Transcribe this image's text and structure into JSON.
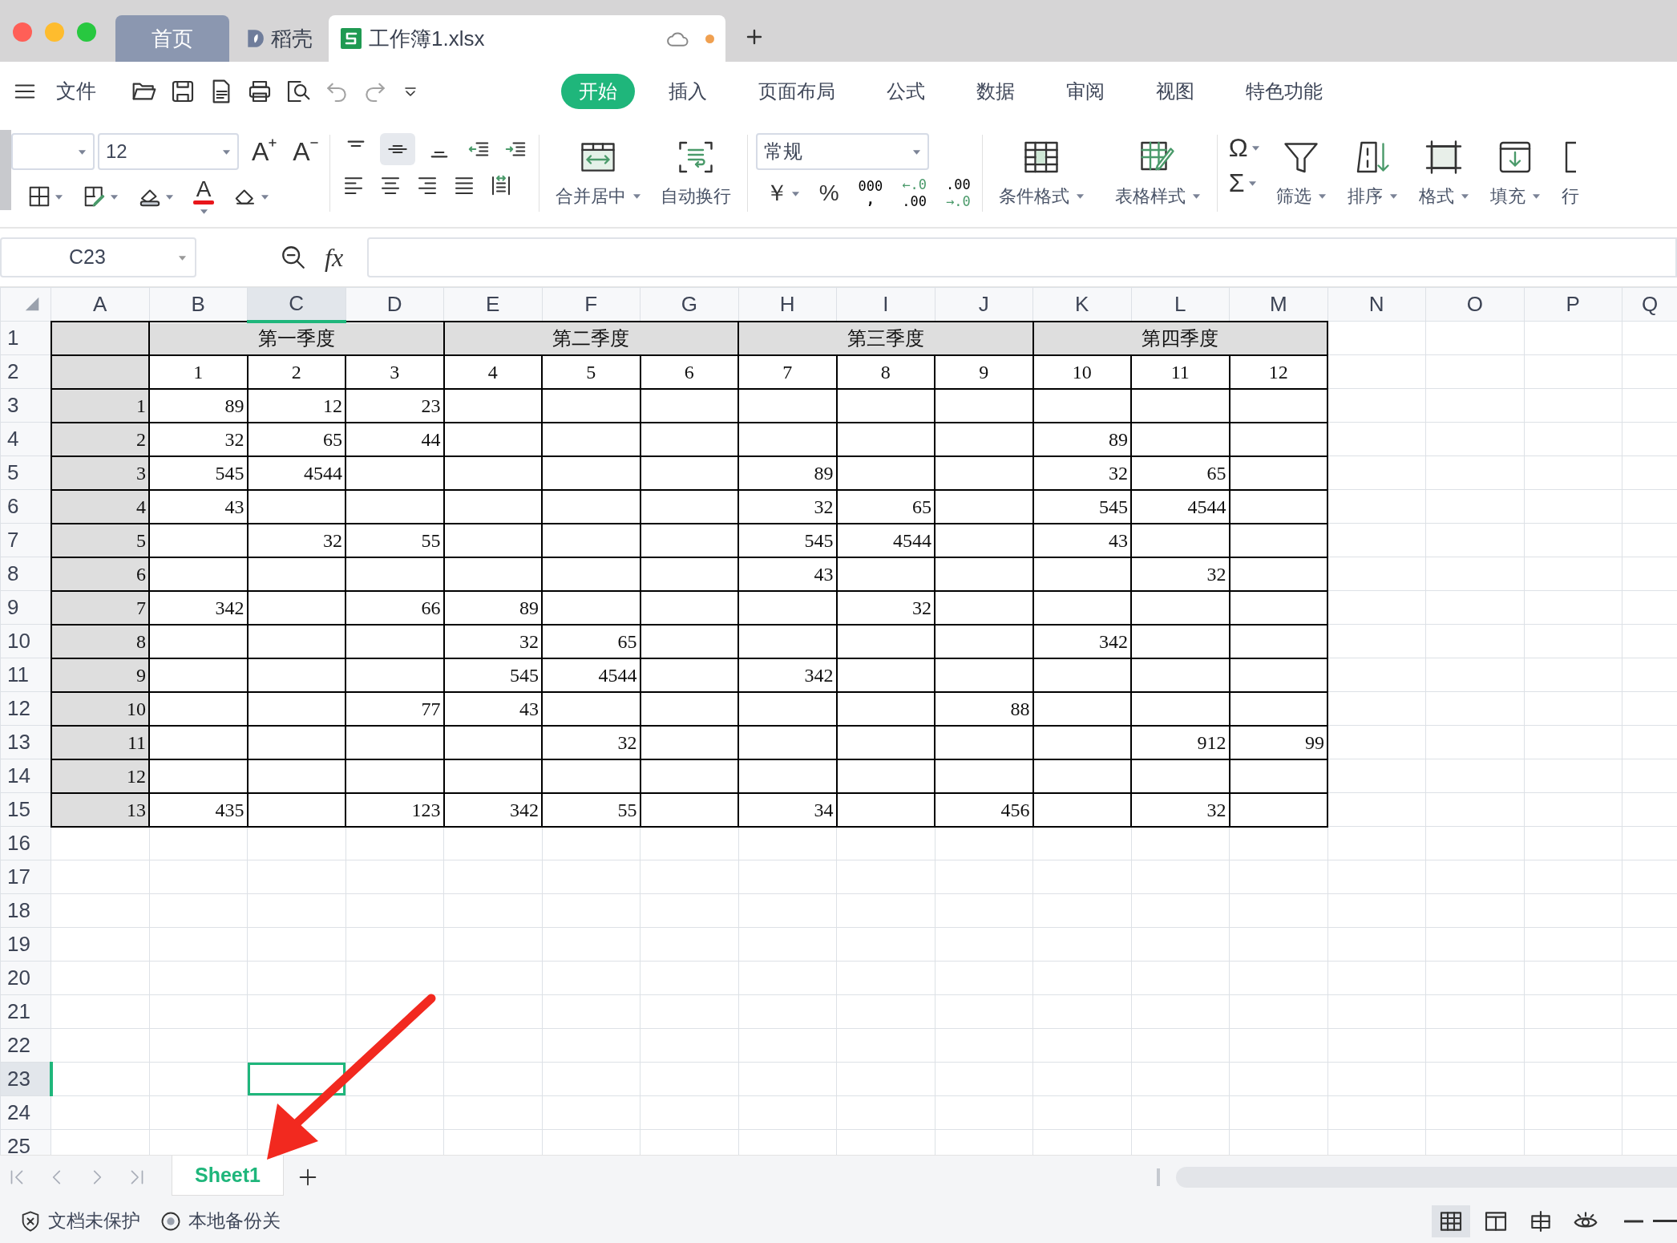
{
  "window": {
    "tabs": [
      {
        "kind": "home",
        "label": "首页",
        "selected": false
      },
      {
        "kind": "docer",
        "label": "稻壳",
        "selected": false
      },
      {
        "kind": "file",
        "label": "工作簿1.xlsx",
        "selected": true,
        "unsaved": true
      }
    ]
  },
  "menu": {
    "file_label": "文件",
    "quick_access": [
      {
        "kind": "open",
        "disabled": false
      },
      {
        "kind": "save",
        "disabled": false
      },
      {
        "kind": "pdf",
        "disabled": false
      },
      {
        "kind": "print",
        "disabled": false
      },
      {
        "kind": "preview",
        "disabled": false
      },
      {
        "kind": "undo",
        "disabled": true
      },
      {
        "kind": "redo",
        "disabled": true
      },
      {
        "kind": "customize",
        "disabled": false
      }
    ],
    "ribbon_tabs": [
      {
        "label": "开始",
        "selected": true
      },
      {
        "label": "插入",
        "selected": false
      },
      {
        "label": "页面布局",
        "selected": false
      },
      {
        "label": "公式",
        "selected": false
      },
      {
        "label": "数据",
        "selected": false
      },
      {
        "label": "审阅",
        "selected": false
      },
      {
        "label": "视图",
        "selected": false
      },
      {
        "label": "特色功能",
        "selected": false
      }
    ]
  },
  "toolbar": {
    "font_size": "12",
    "font_buttons": [
      {
        "kind": "grow",
        "label": "A"
      },
      {
        "kind": "shrink",
        "label": "A"
      },
      {
        "kind": "color",
        "label": "A"
      }
    ],
    "vertical_align_buttons": [
      {
        "kind": "top",
        "selected": false
      },
      {
        "kind": "middle",
        "selected": true
      },
      {
        "kind": "bottom",
        "selected": false
      }
    ],
    "merge_buttons": [
      {
        "kind": "merge",
        "label": "合并居中",
        "dropdown": true
      },
      {
        "kind": "wrap",
        "label": "自动换行",
        "dropdown": false
      }
    ],
    "number_format": "常规",
    "number_buttons": [
      {
        "kind": "currency",
        "label": "￥"
      },
      {
        "kind": "percent",
        "label": "%"
      },
      {
        "kind": "thousands",
        "label": "000",
        "sublabel": ","
      },
      {
        "kind": "dec_add",
        "label": "←.0",
        "sublabel": ".00"
      },
      {
        "kind": "dec_remove",
        "label": ".00",
        "sublabel": "→.0"
      }
    ],
    "style_buttons": [
      {
        "kind": "conditional",
        "label": "条件格式",
        "dropdown": true
      },
      {
        "kind": "table_style",
        "label": "表格样式",
        "dropdown": true
      }
    ],
    "math_buttons": [
      {
        "label": "Ω"
      },
      {
        "label": "Σ"
      }
    ],
    "edit_buttons": [
      {
        "kind": "filter",
        "label": "筛选",
        "dropdown": true
      },
      {
        "kind": "sort",
        "label": "排序",
        "dropdown": true
      },
      {
        "kind": "format",
        "label": "格式",
        "dropdown": true
      },
      {
        "kind": "fill",
        "label": "填充",
        "dropdown": true
      },
      {
        "kind": "rowcol",
        "label": "行",
        "dropdown": false
      }
    ]
  },
  "formula_bar": {
    "cell_ref": "C23",
    "fx": "fx"
  },
  "sheet": {
    "columns": [
      {
        "label": "A",
        "selected": false
      },
      {
        "label": "B",
        "selected": false
      },
      {
        "label": "C",
        "selected": true
      },
      {
        "label": "D",
        "selected": false
      },
      {
        "label": "E",
        "selected": false
      },
      {
        "label": "F",
        "selected": false
      },
      {
        "label": "G",
        "selected": false
      },
      {
        "label": "H",
        "selected": false
      },
      {
        "label": "I",
        "selected": false
      },
      {
        "label": "J",
        "selected": false
      },
      {
        "label": "K",
        "selected": false
      },
      {
        "label": "L",
        "selected": false
      },
      {
        "label": "M",
        "selected": false
      },
      {
        "label": "N",
        "selected": false
      },
      {
        "label": "O",
        "selected": false
      },
      {
        "label": "P",
        "selected": false
      },
      {
        "label": "Q",
        "selected": false
      }
    ],
    "rows": [
      {
        "header": "1",
        "selected": false,
        "kind": "quarter_header",
        "cells": [
          null,
          "第一季度",
          null,
          null,
          "第二季度",
          null,
          null,
          "第三季度",
          null,
          null,
          "第四季度"
        ]
      },
      {
        "header": "2",
        "selected": false,
        "kind": "month_header",
        "cells": [
          null,
          "1",
          "2",
          "3",
          "4",
          "5",
          "6",
          "7",
          "8",
          "9",
          "10",
          "11",
          "12"
        ]
      },
      {
        "header": "3",
        "selected": false,
        "kind": "data",
        "cells": [
          "1",
          "89",
          "12",
          "23"
        ]
      },
      {
        "header": "4",
        "selected": false,
        "kind": "data",
        "cells": [
          "2",
          "32",
          "65",
          "44",
          null,
          null,
          null,
          null,
          null,
          null,
          "89"
        ]
      },
      {
        "header": "5",
        "selected": false,
        "kind": "data",
        "cells": [
          "3",
          "545",
          "4544",
          null,
          null,
          null,
          null,
          "89",
          null,
          null,
          "32",
          "65"
        ]
      },
      {
        "header": "6",
        "selected": false,
        "kind": "data",
        "cells": [
          "4",
          "43",
          null,
          null,
          null,
          null,
          null,
          "32",
          "65",
          null,
          "545",
          "4544"
        ]
      },
      {
        "header": "7",
        "selected": false,
        "kind": "data",
        "cells": [
          "5",
          null,
          "32",
          "55",
          null,
          null,
          null,
          "545",
          "4544",
          null,
          "43"
        ]
      },
      {
        "header": "8",
        "selected": false,
        "kind": "data",
        "cells": [
          "6",
          null,
          null,
          null,
          null,
          null,
          null,
          "43",
          null,
          null,
          null,
          "32"
        ]
      },
      {
        "header": "9",
        "selected": false,
        "kind": "data",
        "cells": [
          "7",
          "342",
          null,
          "66",
          "89",
          null,
          null,
          null,
          "32"
        ]
      },
      {
        "header": "10",
        "selected": false,
        "kind": "data",
        "cells": [
          "8",
          null,
          null,
          null,
          "32",
          "65",
          null,
          null,
          null,
          null,
          "342"
        ]
      },
      {
        "header": "11",
        "selected": false,
        "kind": "data",
        "cells": [
          "9",
          null,
          null,
          null,
          "545",
          "4544",
          null,
          "342"
        ]
      },
      {
        "header": "12",
        "selected": false,
        "kind": "data",
        "cells": [
          "10",
          null,
          null,
          "77",
          "43",
          null,
          null,
          null,
          null,
          "88"
        ]
      },
      {
        "header": "13",
        "selected": false,
        "kind": "data",
        "cells": [
          "11",
          null,
          null,
          null,
          null,
          "32",
          null,
          null,
          null,
          null,
          null,
          "912",
          "99"
        ]
      },
      {
        "header": "14",
        "selected": false,
        "kind": "data",
        "cells": [
          "12"
        ]
      },
      {
        "header": "15",
        "selected": false,
        "kind": "data",
        "cells": [
          "13",
          "435",
          null,
          "123",
          "342",
          "55",
          null,
          "34",
          null,
          "456",
          null,
          "32"
        ]
      },
      {
        "header": "16",
        "selected": false,
        "kind": "empty"
      },
      {
        "header": "17",
        "selected": false,
        "kind": "empty"
      },
      {
        "header": "18",
        "selected": false,
        "kind": "empty"
      },
      {
        "header": "19",
        "selected": false,
        "kind": "empty"
      },
      {
        "header": "20",
        "selected": false,
        "kind": "empty"
      },
      {
        "header": "21",
        "selected": false,
        "kind": "empty"
      },
      {
        "header": "22",
        "selected": false,
        "kind": "empty"
      },
      {
        "header": "23",
        "selected": true,
        "kind": "empty"
      },
      {
        "header": "24",
        "selected": false,
        "kind": "empty"
      },
      {
        "header": "25",
        "selected": false,
        "kind": "empty"
      }
    ]
  },
  "sheet_tabs": [
    {
      "label": "Sheet1",
      "selected": true
    }
  ],
  "status_bar": {
    "protection": "文档未保护",
    "backup": "本地备份关",
    "view_buttons": [
      {
        "kind": "normal",
        "selected": true
      },
      {
        "kind": "page",
        "selected": false
      },
      {
        "kind": "split",
        "selected": false
      },
      {
        "kind": "reading",
        "selected": false
      }
    ]
  }
}
